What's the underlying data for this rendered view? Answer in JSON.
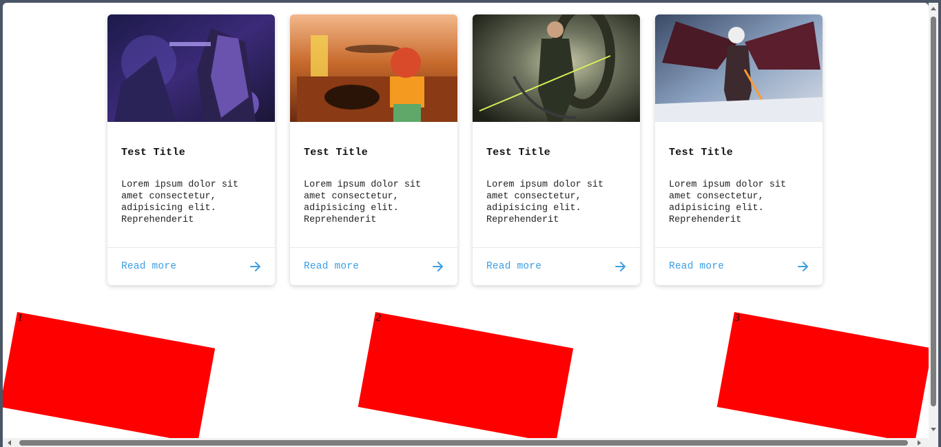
{
  "cards": [
    {
      "title": "Test Title",
      "text": "Lorem ipsum dolor sit amet consectetur, adipisicing elit. Reprehenderit",
      "link_label": "Read more",
      "icon": "arrow-right-icon"
    },
    {
      "title": "Test Title",
      "text": "Lorem ipsum dolor sit amet consectetur, adipisicing elit. Reprehenderit",
      "link_label": "Read more",
      "icon": "arrow-right-icon"
    },
    {
      "title": "Test Title",
      "text": "Lorem ipsum dolor sit amet consectetur, adipisicing elit. Reprehenderit",
      "link_label": "Read more",
      "icon": "arrow-right-icon"
    },
    {
      "title": "Test Title",
      "text": "Lorem ipsum dolor sit amet consectetur, adipisicing elit. Reprehenderit",
      "link_label": "Read more",
      "icon": "arrow-right-icon"
    }
  ],
  "boxes": [
    {
      "label": "1"
    },
    {
      "label": "2"
    },
    {
      "label": "3"
    }
  ],
  "colors": {
    "link": "#3a9ee4",
    "box": "#ff0000",
    "card_bg": "#ffffff"
  }
}
